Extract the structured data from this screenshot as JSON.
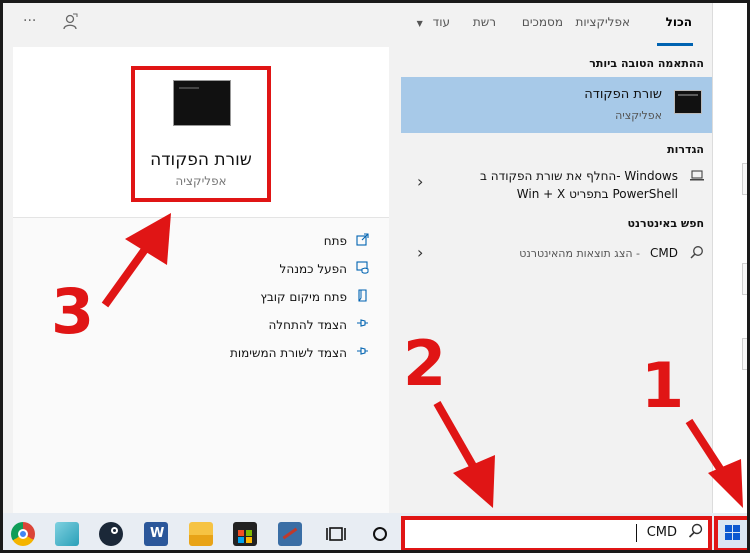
{
  "tabs": [
    {
      "label": "הכול",
      "active": true
    },
    {
      "label": "אפליקציות",
      "active": false
    },
    {
      "label": "מסמכים",
      "active": false
    },
    {
      "label": "רשת",
      "active": false
    },
    {
      "label": "עוד",
      "active": false
    }
  ],
  "more_chevron": "▼",
  "top_icons": {
    "feedback": "feedback-icon",
    "ellipsis": "···"
  },
  "results": {
    "best_match_title": "ההתאמה הטובה ביותר",
    "best_match": {
      "title": "שורת הפקודה",
      "subtitle": "אפליקציה"
    },
    "settings_title": "הגדרות",
    "settings_item": {
      "line1": "Windows -החלף את שורת הפקודה ב",
      "line2": "PowerShell בתפריט Win + X"
    },
    "web_title": "חפש באינטרנט",
    "web_item": {
      "query": "CMD",
      "suffix": "- הצג תוצאות מהאינטרנט"
    }
  },
  "preview": {
    "title": "שורת הפקודה",
    "subtitle": "אפליקציה",
    "actions": [
      {
        "label": "פתח",
        "icon": "open-icon"
      },
      {
        "label": "הפעל כמנהל",
        "icon": "admin-icon"
      },
      {
        "label": "פתח מיקום קובץ",
        "icon": "file-location-icon"
      },
      {
        "label": "הצמד להתחלה",
        "icon": "pin-start-icon"
      },
      {
        "label": "הצמד לשורת המשימות",
        "icon": "pin-taskbar-icon"
      }
    ]
  },
  "search": {
    "value": "CMD"
  },
  "annotations": {
    "one": "1",
    "two": "2",
    "three": "3"
  },
  "colors": {
    "accent": "#0063b1",
    "selected": "#a7c9e8",
    "annotation": "#e01515"
  }
}
